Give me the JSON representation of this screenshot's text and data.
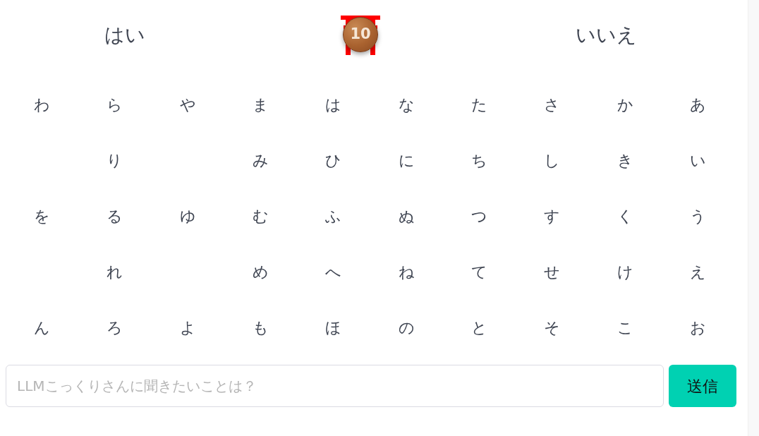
{
  "answers": [
    {
      "label": "はい"
    },
    {
      "label": "いいえ"
    }
  ],
  "coin": {
    "count": "10"
  },
  "kana_board": {
    "rows": [
      {
        "cells": [
          {
            "kind": "kana",
            "text": "わ"
          },
          {
            "kind": "kana",
            "text": "ら"
          },
          {
            "kind": "kana",
            "text": "や"
          },
          {
            "kind": "kana",
            "text": "ま"
          },
          {
            "kind": "kana",
            "text": "は"
          },
          {
            "kind": "kana",
            "text": "な"
          },
          {
            "kind": "kana",
            "text": "た"
          },
          {
            "kind": "kana",
            "text": "さ"
          },
          {
            "kind": "kana",
            "text": "か"
          },
          {
            "kind": "kana",
            "text": "あ"
          }
        ]
      },
      {
        "cells": [
          {
            "kind": "blank"
          },
          {
            "kind": "kana",
            "text": "り"
          },
          {
            "kind": "blank"
          },
          {
            "kind": "kana",
            "text": "み"
          },
          {
            "kind": "kana",
            "text": "ひ"
          },
          {
            "kind": "kana",
            "text": "に"
          },
          {
            "kind": "kana",
            "text": "ち"
          },
          {
            "kind": "kana",
            "text": "し"
          },
          {
            "kind": "kana",
            "text": "き"
          },
          {
            "kind": "kana",
            "text": "い"
          }
        ]
      },
      {
        "cells": [
          {
            "kind": "kana",
            "text": "を"
          },
          {
            "kind": "kana",
            "text": "る"
          },
          {
            "kind": "kana",
            "text": "ゆ"
          },
          {
            "kind": "kana",
            "text": "む"
          },
          {
            "kind": "kana",
            "text": "ふ"
          },
          {
            "kind": "kana",
            "text": "ぬ"
          },
          {
            "kind": "kana",
            "text": "つ"
          },
          {
            "kind": "kana",
            "text": "す"
          },
          {
            "kind": "kana",
            "text": "く"
          },
          {
            "kind": "kana",
            "text": "う"
          }
        ]
      },
      {
        "cells": [
          {
            "kind": "blank"
          },
          {
            "kind": "kana",
            "text": "れ"
          },
          {
            "kind": "blank"
          },
          {
            "kind": "kana",
            "text": "め"
          },
          {
            "kind": "kana",
            "text": "へ"
          },
          {
            "kind": "kana",
            "text": "ね"
          },
          {
            "kind": "kana",
            "text": "て"
          },
          {
            "kind": "kana",
            "text": "せ"
          },
          {
            "kind": "kana",
            "text": "け"
          },
          {
            "kind": "kana",
            "text": "え"
          }
        ]
      },
      {
        "cells": [
          {
            "kind": "kana",
            "text": "ん"
          },
          {
            "kind": "kana",
            "text": "ろ"
          },
          {
            "kind": "kana",
            "text": "よ"
          },
          {
            "kind": "kana",
            "text": "も"
          },
          {
            "kind": "kana",
            "text": "ほ"
          },
          {
            "kind": "kana",
            "text": "の"
          },
          {
            "kind": "kana",
            "text": "と"
          },
          {
            "kind": "kana",
            "text": "そ"
          },
          {
            "kind": "kana",
            "text": "こ"
          },
          {
            "kind": "kana",
            "text": "お"
          }
        ]
      }
    ]
  },
  "question": {
    "placeholder": "LLMこっくりさんに聞きたいことは？"
  },
  "submit": {
    "label": "送信"
  }
}
